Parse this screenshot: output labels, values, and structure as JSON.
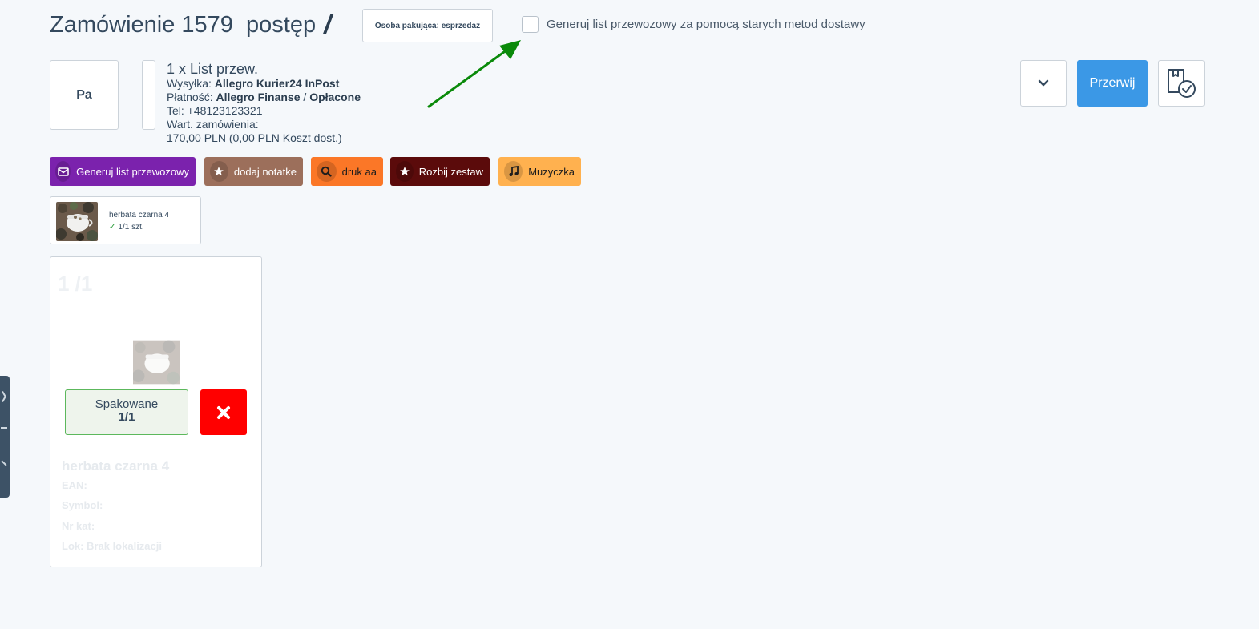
{
  "header": {
    "title": "Zamówienie 1579  postęp",
    "slash": "/",
    "packer_label": "Osoba pakująca: esprzedaz",
    "old_methods_checkbox_label": "Generuj list przewozowy za pomocą starych metod dostawy",
    "old_methods_checked": false
  },
  "order": {
    "pa_label": "Pa",
    "shipment_title": "1 x List przew.",
    "shipping_label": "Wysyłka:",
    "shipping_value": "Allegro Kurier24 InPost",
    "payment_label": "Płatność:",
    "payment_provider": "Allegro Finanse",
    "payment_separator": "/",
    "payment_status": "Opłacone",
    "phone": "Tel: +48123123321",
    "order_value_label": "Wart. zamówienia:",
    "order_value": "170,00 PLN (0,00 PLN Koszt dost.)"
  },
  "toolbar": {
    "stop_label": "Przerwij"
  },
  "actions": [
    {
      "label": "Generuj list przewozowy",
      "icon": "envelope-icon",
      "color": "#7b22ad"
    },
    {
      "label": "dodaj notatke",
      "icon": "star-icon",
      "color": "#9c6f5b"
    },
    {
      "label": "druk aa",
      "icon": "search-icon",
      "color": "#fb7727"
    },
    {
      "label": "Rozbij zestaw",
      "icon": "star-icon",
      "color": "#5b0b0b"
    },
    {
      "label": "Muzyczka",
      "icon": "music-note-icon",
      "color": "#ffb14f"
    }
  ],
  "product_summary": {
    "name": "herbata czarna 4",
    "qty": "1/1 szt."
  },
  "product_card": {
    "counter": "1 /1",
    "packed_label": "Spakowane",
    "packed_count": "1/1",
    "name": "herbata czarna 4",
    "ean": "EAN:",
    "symbol": "Symbol:",
    "catalog": "Nr kat:",
    "location": "Lok: Brak lokalizacji"
  },
  "colors": {
    "primary": "#3b98e6",
    "danger": "#ff0000",
    "success": "#5cb85c",
    "arrow": "#0a8a0a"
  }
}
